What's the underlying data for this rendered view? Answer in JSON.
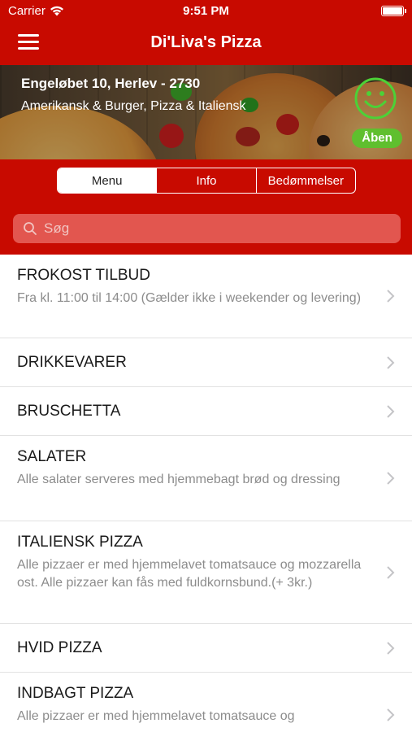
{
  "status_bar": {
    "carrier": "Carrier",
    "time": "9:51 PM"
  },
  "nav": {
    "title": "Di'Liva's Pizza",
    "menu_icon": "hamburger-icon"
  },
  "restaurant": {
    "address": "Engeløbet 10, Herlev - 2730",
    "cuisine": "Amerikansk & Burger, Pizza & Italiensk",
    "status_label": "Åben",
    "status_icon": "smiley-icon"
  },
  "tabs": [
    {
      "label": "Menu",
      "active": true
    },
    {
      "label": "Info",
      "active": false
    },
    {
      "label": "Bedømmelser",
      "active": false
    }
  ],
  "search": {
    "placeholder": "Søg",
    "value": ""
  },
  "categories": [
    {
      "title": "FROKOST TILBUD",
      "description": "Fra kl. 11:00 til 14:00 (Gælder ikke i weekender og levering)"
    },
    {
      "title": "DRIKKEVARER",
      "description": ""
    },
    {
      "title": "BRUSCHETTA",
      "description": ""
    },
    {
      "title": "SALATER",
      "description": "Alle salater serveres med hjemmebagt brød og dressing"
    },
    {
      "title": "ITALIENSK PIZZA",
      "description": "Alle pizzaer er med hjemmelavet tomatsauce og mozzarella ost. Alle pizzaer kan fås med fuldkornsbund.(+ 3kr.)"
    },
    {
      "title": "HVID PIZZA",
      "description": ""
    },
    {
      "title": "INDBAGT PIZZA",
      "description": "Alle pizzaer er med hjemmelavet tomatsauce og"
    }
  ],
  "colors": {
    "brand_red": "#c80a00",
    "open_green": "#5fbf2e",
    "smiley_green": "#4cd137"
  }
}
